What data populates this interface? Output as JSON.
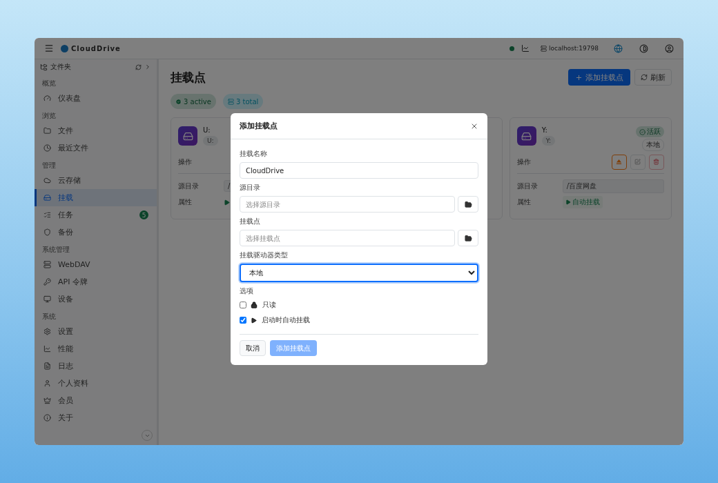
{
  "topbar": {
    "brand": "CloudDrive",
    "server": "localhost:19798"
  },
  "sidebar": {
    "header": "文件夹",
    "sections": [
      {
        "title": "概览",
        "items": [
          {
            "label": "仪表盘",
            "selected": false
          }
        ]
      },
      {
        "title": "浏览",
        "items": [
          {
            "label": "文件",
            "selected": false
          },
          {
            "label": "最近文件",
            "selected": false
          }
        ]
      },
      {
        "title": "管理",
        "items": [
          {
            "label": "云存储",
            "selected": false
          },
          {
            "label": "挂载",
            "selected": true
          },
          {
            "label": "任务",
            "selected": false,
            "badge": "5"
          },
          {
            "label": "备份",
            "selected": false
          }
        ]
      },
      {
        "title": "系统管理",
        "items": [
          {
            "label": "WebDAV",
            "selected": false
          },
          {
            "label": "API 令牌",
            "selected": false
          },
          {
            "label": "设备",
            "selected": false
          }
        ]
      },
      {
        "title": "系统",
        "items": [
          {
            "label": "设置",
            "selected": false
          },
          {
            "label": "性能",
            "selected": false
          },
          {
            "label": "日志",
            "selected": false
          },
          {
            "label": "个人资料",
            "selected": false
          },
          {
            "label": "会员",
            "selected": false
          },
          {
            "label": "关于",
            "selected": false
          }
        ]
      }
    ]
  },
  "page": {
    "title": "挂载点",
    "add_button": "添加挂载点",
    "refresh_button": "刷新",
    "stats": [
      {
        "kind": "active",
        "label": "3 active"
      },
      {
        "kind": "total",
        "label": "3 total"
      }
    ]
  },
  "cards": [
    {
      "kind": "partial",
      "name": "U:",
      "tag": "U:",
      "actions_label": "操作",
      "source_label": "源目录",
      "source": "/",
      "props_label": "属性"
    },
    {
      "kind": "covered"
    },
    {
      "kind": "full",
      "name": "Y:",
      "tag": "Y:",
      "status": "活跃",
      "type": "本地",
      "actions_label": "操作",
      "source_label": "源目录",
      "source": "/百度网盘",
      "props_label": "属性",
      "prop": "自动挂载"
    }
  ],
  "dialog": {
    "title": "添加挂载点",
    "fields": [
      {
        "kind": "text",
        "label": "挂载名称",
        "value": "CloudDrive"
      },
      {
        "kind": "browse",
        "label": "源目录",
        "placeholder": "选择源目录"
      },
      {
        "kind": "browse",
        "label": "挂载点",
        "placeholder": "选择挂载点"
      },
      {
        "kind": "select",
        "label": "挂载驱动器类型",
        "value": "本地"
      }
    ],
    "options_label": "选项",
    "options": [
      {
        "label": "只读",
        "checked": false
      },
      {
        "label": "启动时自动挂载",
        "checked": true
      }
    ],
    "cancel": "取消",
    "submit": "添加挂载点",
    "submit_disabled": true
  }
}
